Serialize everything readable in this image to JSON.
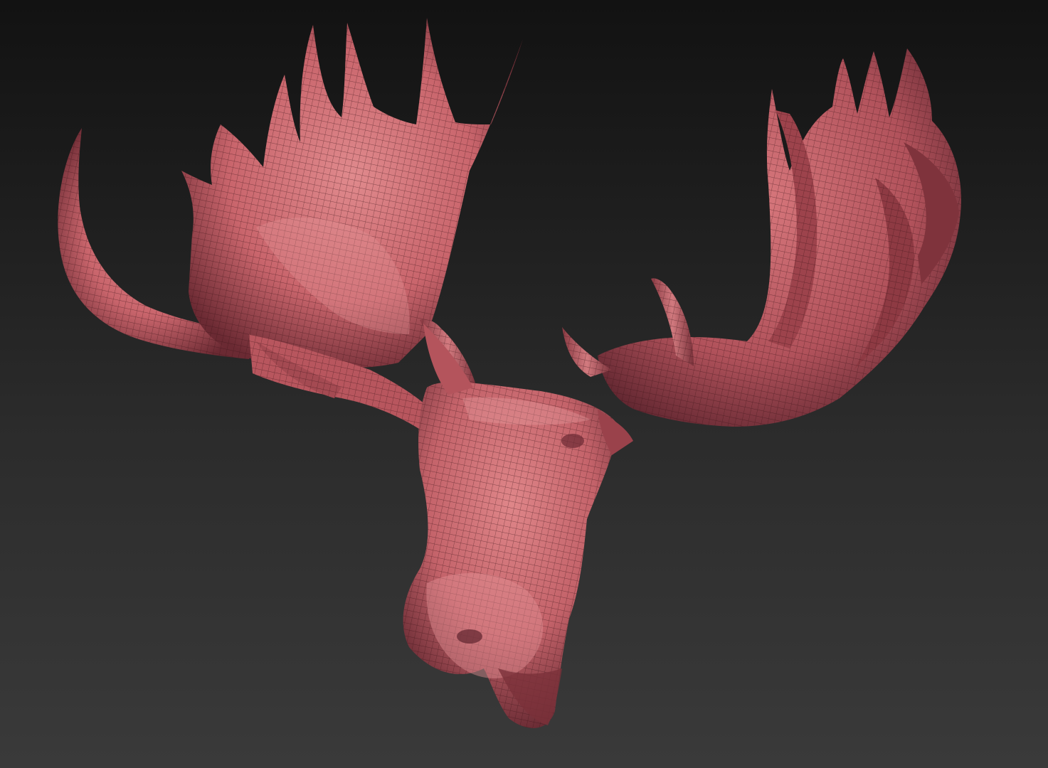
{
  "viewport": {
    "background_top": "#121212",
    "background_bottom": "#3a3a3a"
  },
  "model": {
    "subject": "moose-head-mesh",
    "base_color": "#d9757a",
    "shadow_color": "#6b2a33",
    "wireframe_color": "#3a1216",
    "display_mode": "polyframe"
  }
}
